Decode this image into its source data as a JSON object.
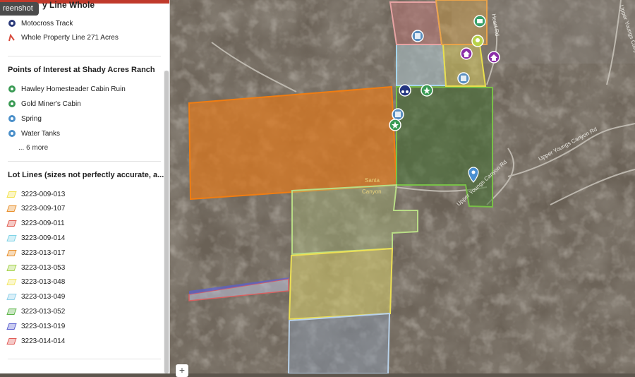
{
  "tooltip": "reenshot",
  "section_top": {
    "title": "y Line Whole",
    "items": [
      {
        "label": "Motocross Track",
        "icon": "motocross-icon"
      },
      {
        "label": "Whole Property Line 271 Acres",
        "icon": "line-icon"
      }
    ]
  },
  "poi": {
    "title": "Points of Interest at Shady Acres Ranch",
    "items": [
      {
        "label": "Hawley Homesteader Cabin Ruin",
        "icon": "star-icon",
        "color": "#3a9a54"
      },
      {
        "label": "Gold Miner's Cabin",
        "icon": "star-icon",
        "color": "#3a9a54"
      },
      {
        "label": "Spring",
        "icon": "water-icon",
        "color": "#4a8fc9"
      },
      {
        "label": "Water Tanks",
        "icon": "water-icon",
        "color": "#4a8fc9"
      }
    ],
    "more": "... 6 more"
  },
  "lots": {
    "title": "Lot Lines (sizes not perfectly accurate, a...",
    "items": [
      {
        "label": "3223-009-013",
        "color": "#f2e24a"
      },
      {
        "label": "3223-009-107",
        "color": "#e88f2b"
      },
      {
        "label": "3223-009-011",
        "color": "#e15a4f"
      },
      {
        "label": "3223-009-014",
        "color": "#7fd3e6"
      },
      {
        "label": "3223-013-017",
        "color": "#e88f2b"
      },
      {
        "label": "3223-013-053",
        "color": "#a6d34e"
      },
      {
        "label": "3223-013-048",
        "color": "#f2e86a"
      },
      {
        "label": "3223-013-049",
        "color": "#8fd0ea"
      },
      {
        "label": "3223-013-052",
        "color": "#5cb548"
      },
      {
        "label": "3223-013-019",
        "color": "#5a5fd0"
      },
      {
        "label": "3223-014-014",
        "color": "#e05a55"
      }
    ]
  },
  "map": {
    "labels": {
      "road1": "Upper Youngs Canyon Rd",
      "road2": "Upper Youngs Canyon Rd",
      "road3": "Upper Youngs Canyon Rd",
      "road4": "Heart Rd",
      "canyon_line1": "Santa",
      "canyon_line2": "Canyon"
    },
    "zoom_in": "+"
  }
}
